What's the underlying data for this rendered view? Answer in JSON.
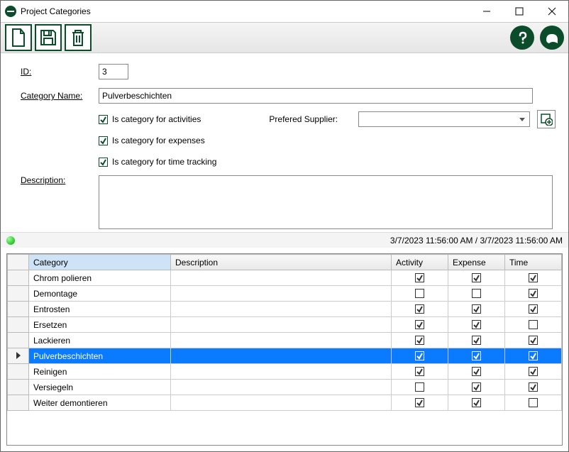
{
  "window": {
    "title": "Project Categories"
  },
  "toolbar": {
    "new": "New",
    "save": "Save",
    "delete": "Delete",
    "help": "Help",
    "about": "About"
  },
  "form": {
    "id_label": "ID:",
    "id_value": "3",
    "name_label": "Category Name:",
    "name_value": "Pulverbeschichten",
    "activities_label": "Is category for activities",
    "activities_checked": true,
    "expenses_label": "Is category for expenses",
    "expenses_checked": true,
    "timetracking_label": "Is category for time tracking",
    "timetracking_checked": true,
    "supplier_label": "Prefered Supplier:",
    "supplier_value": "",
    "description_label": "Description:",
    "description_value": ""
  },
  "status": {
    "timestamps": "3/7/2023 11:56:00 AM / 3/7/2023 11:56:00 AM"
  },
  "grid": {
    "columns": {
      "category": "Category",
      "description": "Description",
      "activity": "Activity",
      "expense": "Expense",
      "time": "Time"
    },
    "rows": [
      {
        "category": "Chrom polieren",
        "description": "",
        "activity": true,
        "expense": true,
        "time": true,
        "selected": false
      },
      {
        "category": "Demontage",
        "description": "",
        "activity": false,
        "expense": false,
        "time": true,
        "selected": false
      },
      {
        "category": "Entrosten",
        "description": "",
        "activity": true,
        "expense": true,
        "time": true,
        "selected": false
      },
      {
        "category": "Ersetzen",
        "description": "",
        "activity": true,
        "expense": true,
        "time": false,
        "selected": false
      },
      {
        "category": "Lackieren",
        "description": "",
        "activity": true,
        "expense": true,
        "time": true,
        "selected": false
      },
      {
        "category": "Pulverbeschichten",
        "description": "",
        "activity": true,
        "expense": true,
        "time": true,
        "selected": true
      },
      {
        "category": "Reinigen",
        "description": "",
        "activity": true,
        "expense": true,
        "time": true,
        "selected": false
      },
      {
        "category": "Versiegeln",
        "description": "",
        "activity": false,
        "expense": true,
        "time": true,
        "selected": false
      },
      {
        "category": "Weiter demontieren",
        "description": "",
        "activity": true,
        "expense": true,
        "time": false,
        "selected": false
      }
    ]
  }
}
